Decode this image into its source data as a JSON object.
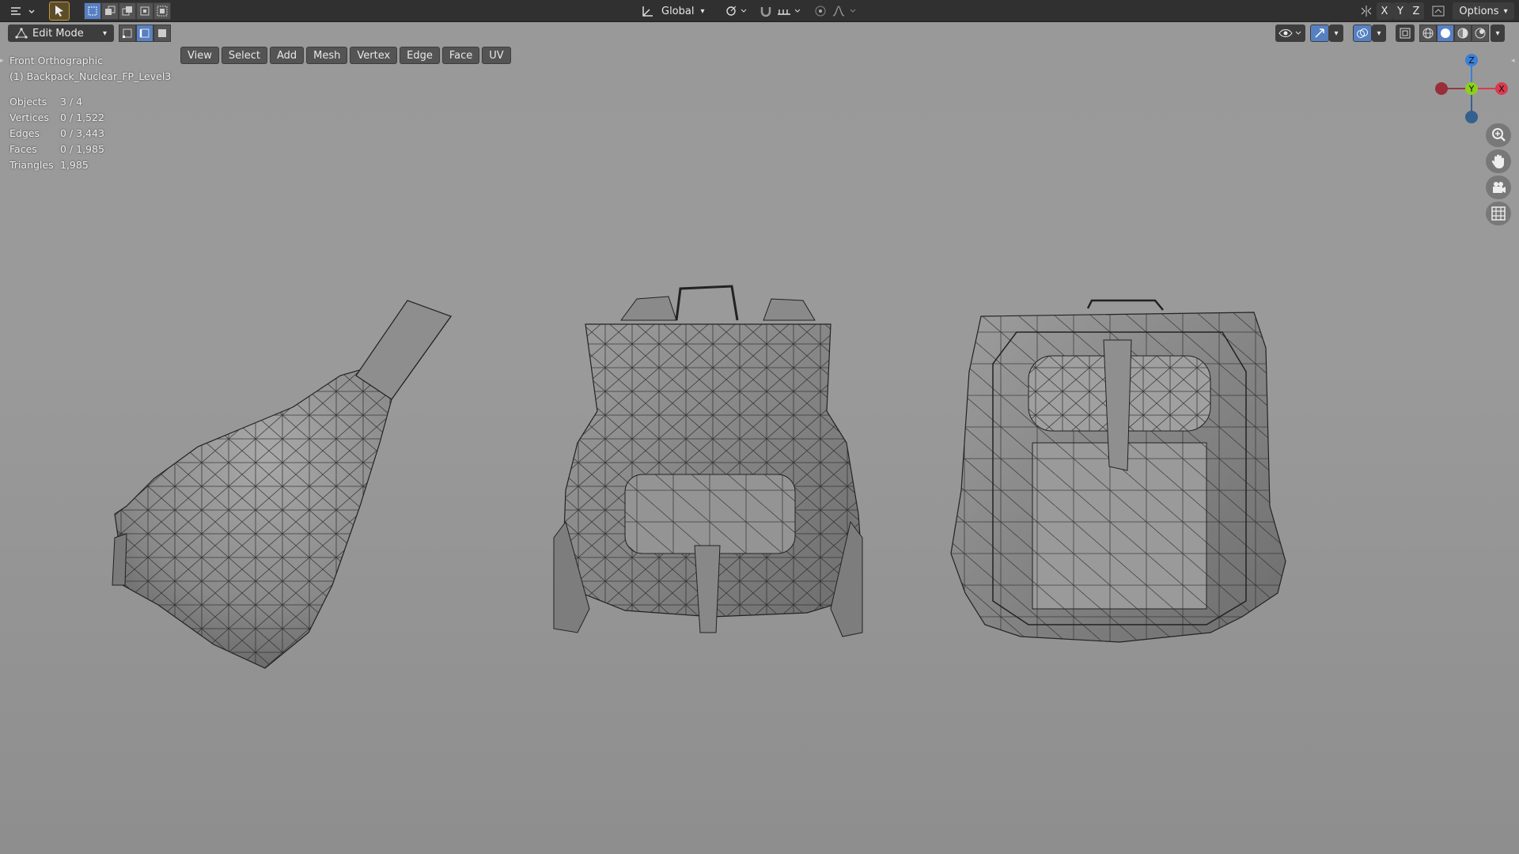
{
  "topbar": {
    "orientation_label": "Global",
    "axis_x": "X",
    "axis_y": "Y",
    "axis_z": "Z",
    "options_label": "Options"
  },
  "header": {
    "mode_label": "Edit Mode",
    "menus": [
      "View",
      "Select",
      "Add",
      "Mesh",
      "Vertex",
      "Edge",
      "Face",
      "UV"
    ]
  },
  "viewport": {
    "view_name": "Front Orthographic",
    "object_name": "(1) Backpack_Nuclear_FP_Level3",
    "stats": [
      {
        "label": "Objects",
        "value": "3 / 4"
      },
      {
        "label": "Vertices",
        "value": "0 / 1,522"
      },
      {
        "label": "Edges",
        "value": "0 / 3,443"
      },
      {
        "label": "Faces",
        "value": "0 / 1,985"
      },
      {
        "label": "Triangles",
        "value": "1,985"
      }
    ],
    "gizmo": {
      "z": "Z",
      "y": "Y",
      "x": "X"
    }
  },
  "colors": {
    "accent": "#5680c2",
    "axis_x": "#d93a4d",
    "axis_y": "#8ccf1d",
    "axis_z": "#3a7fd9"
  }
}
